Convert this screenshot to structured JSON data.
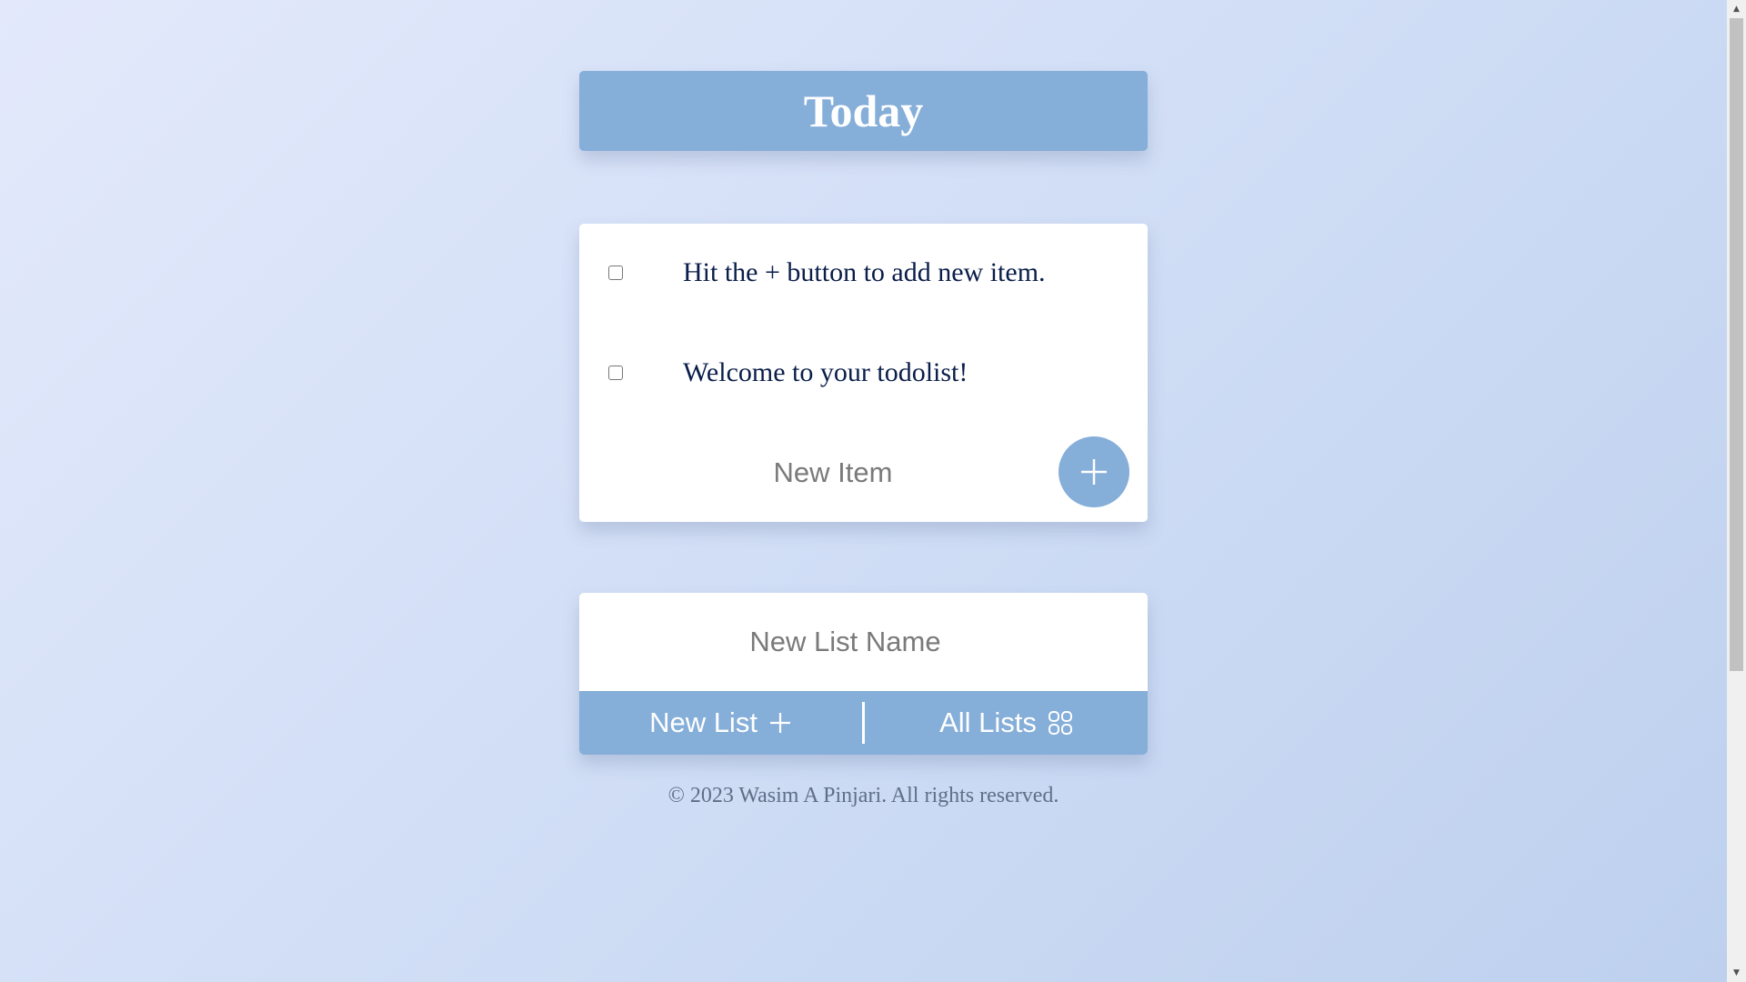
{
  "header": {
    "title": "Today"
  },
  "items": [
    {
      "label": "Hit the + button to add new item.",
      "checked": false
    },
    {
      "label": "Welcome to your todolist!",
      "checked": false
    }
  ],
  "new_item": {
    "placeholder": "New Item",
    "value": "",
    "add_button_icon": "plus-icon"
  },
  "new_list": {
    "placeholder": "New List Name",
    "value": "",
    "new_list_label": "New List",
    "new_list_icon": "plus-icon",
    "all_lists_label": "All Lists",
    "all_lists_icon": "grid-icon"
  },
  "footer": {
    "copyright": "© 2023 Wasim A Pinjari. All rights reserved."
  },
  "colors": {
    "accent": "#85aed9",
    "item_text": "#0a1e4a",
    "copyright_text": "#5e6f86"
  }
}
